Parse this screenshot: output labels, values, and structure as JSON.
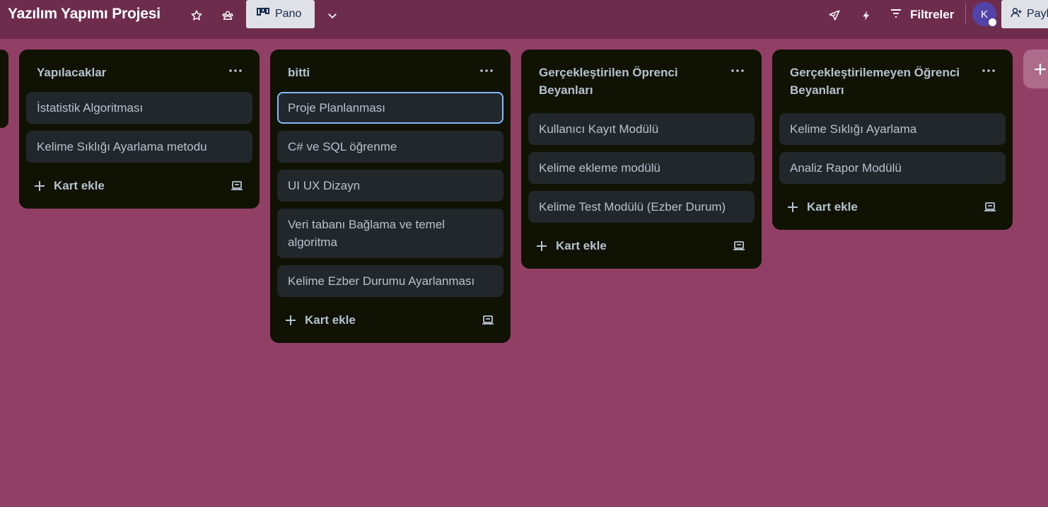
{
  "header": {
    "title": "Yazılım Yapımı Projesi",
    "view_label": "Pano",
    "filter_label": "Filtreler",
    "avatar_initial": "K",
    "share_label": "Paylaş"
  },
  "lists": [
    {
      "title": "Yapılacaklar",
      "cards": [
        "İstatistik Algoritması",
        "Kelime Sıklığı Ayarlama metodu"
      ],
      "add_label": "Kart ekle"
    },
    {
      "title": "bitti",
      "cards": [
        "Proje Planlanması",
        "C# ve SQL öğrenme",
        "UI UX Dizayn",
        "Veri tabanı Bağlama ve temel algoritma",
        "Kelime Ezber Durumu Ayarlanması"
      ],
      "add_label": "Kart ekle"
    },
    {
      "title": "Gerçekleştirilen Öprenci Beyanları",
      "cards": [
        "Kullanıcı Kayıt Modülü",
        "Kelime ekleme modülü",
        "Kelime Test Modülü (Ezber Durum)"
      ],
      "add_label": "Kart ekle"
    },
    {
      "title": "Gerçekleştirilemeyen Öğrenci Beyanları",
      "cards": [
        "Kelime Sıklığı Ayarlama",
        "Analiz Rapor Modülü"
      ],
      "add_label": "Kart ekle"
    }
  ],
  "colors": {
    "board_bg": "#923f66",
    "header_bg": "#6e2c4d",
    "list_bg": "#101204",
    "card_bg": "#22272b",
    "selected_outline": "#85b8ff"
  },
  "icons": {
    "star": "star-icon",
    "visibility": "team-visibility-icon",
    "board": "board-icon",
    "chevron": "chevron-down-icon",
    "power_ups": "rocket-icon",
    "automation": "lightning-icon",
    "filter": "filter-icon",
    "share": "add-person-icon",
    "list_menu": "more-icon",
    "add": "plus-icon",
    "template": "card-template-icon"
  }
}
